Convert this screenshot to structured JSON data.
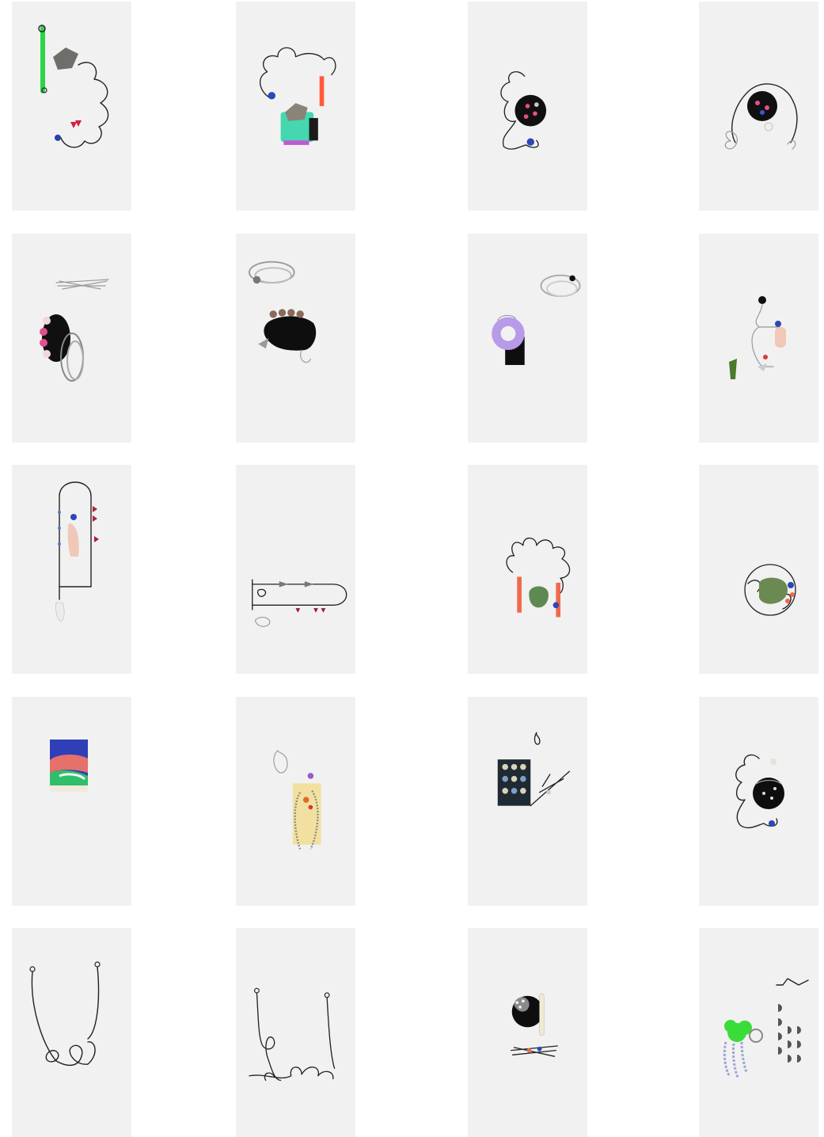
{
  "gallery": {
    "background": "#ffffff",
    "tile_background": "#f1f1f1",
    "columns": 4,
    "rows": 5,
    "tiles": [
      {
        "subject": "wire-loops-green-beads-stone"
      },
      {
        "subject": "wire-loops-teal-block-orange-beads"
      },
      {
        "subject": "wire-loops-black-disc-pink-beads"
      },
      {
        "subject": "wire-arch-black-disc-pearl"
      },
      {
        "subject": "black-disc-buttons-silver-coil"
      },
      {
        "subject": "black-blob-buttons-silver-coil"
      },
      {
        "subject": "lilac-ring-black-shape-coil"
      },
      {
        "subject": "white-wire-pink-bead-green-cone"
      },
      {
        "subject": "rectangle-wire-pink-cone-red-beads"
      },
      {
        "subject": "horizontal-wire-red-drops"
      },
      {
        "subject": "wire-loops-green-stone-coral-beads"
      },
      {
        "subject": "wire-ball-green-stone"
      },
      {
        "subject": "painted-block-blue-green-red"
      },
      {
        "subject": "yellow-block-bead-chain"
      },
      {
        "subject": "dark-panel-half-moons-wire"
      },
      {
        "subject": "wire-loops-black-disc-studs"
      },
      {
        "subject": "u-wire-knot-left"
      },
      {
        "subject": "u-wire-loops-right"
      },
      {
        "subject": "black-disc-sequins-wire"
      },
      {
        "subject": "green-tuft-silver-drops-half-discs"
      }
    ]
  }
}
